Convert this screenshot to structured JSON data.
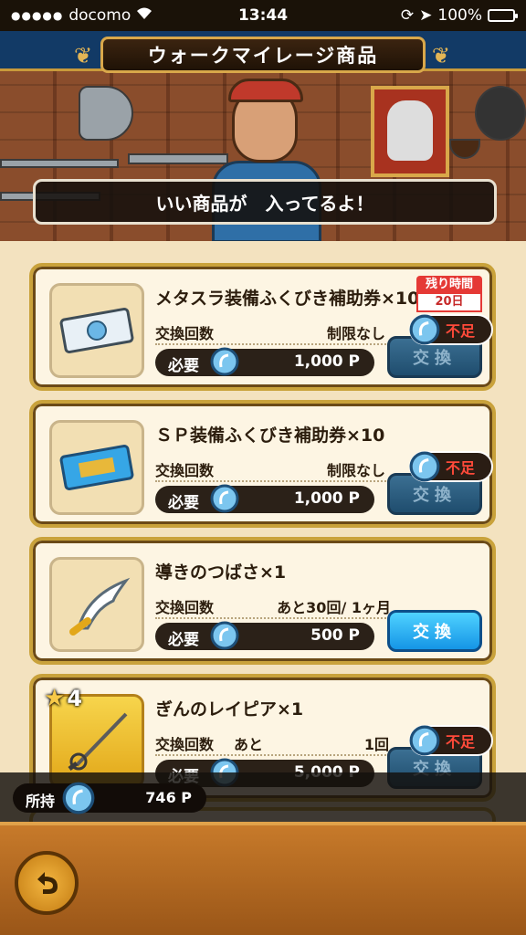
{
  "status_bar": {
    "carrier": "docomo",
    "time": "13:44",
    "battery": "100%"
  },
  "header": {
    "title": "ウォークマイレージ商品",
    "greeting": "いい商品が　入ってるよ！"
  },
  "items": [
    {
      "name": "メタスラ装備ふくびき補助券×10",
      "exchange_count_label": "交換回数",
      "exchange_count_value": "制限なし",
      "need_label": "必要",
      "cost": "1,000 P",
      "button_label": "交換",
      "insufficient_label": "不足",
      "time_label": "残り時間",
      "time_value": "20日"
    },
    {
      "name": "ＳＰ装備ふくびき補助券×10",
      "exchange_count_label": "交換回数",
      "exchange_count_value": "制限なし",
      "need_label": "必要",
      "cost": "1,000 P",
      "button_label": "交換",
      "insufficient_label": "不足"
    },
    {
      "name": "導きのつばさ×1",
      "exchange_count_label": "交換回数",
      "exchange_count_value": "あと30回/ 1ヶ月",
      "need_label": "必要",
      "cost": "500 P",
      "button_label": "交換"
    },
    {
      "name": "ぎんのレイピア×1",
      "rarity": "4",
      "exchange_count_label": "交換回数",
      "exchange_count_prefix": "あと",
      "exchange_count_value": "1回",
      "need_label": "必要",
      "cost": "5,000 P",
      "button_label": "交換",
      "insufficient_label": "不足"
    }
  ],
  "holding": {
    "label": "所持",
    "amount": "746 P"
  },
  "colors": {
    "accent_gold": "#c9a23b",
    "button_blue": "#1595e6",
    "warning_red": "#e53935"
  }
}
